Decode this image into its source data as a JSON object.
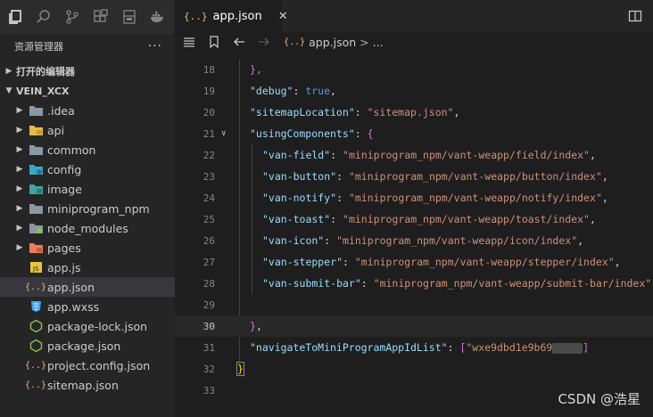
{
  "explorer": {
    "title": "资源管理器",
    "more": "···",
    "sections": [
      {
        "label": "打开的编辑器",
        "expanded": false
      },
      {
        "label": "VEIN_XCX",
        "expanded": true
      }
    ],
    "tree": [
      {
        "label": ".idea",
        "type": "folder",
        "color": "#8b97a1"
      },
      {
        "label": "api",
        "type": "folder",
        "color": "#e5b94b"
      },
      {
        "label": "common",
        "type": "folder",
        "color": "#8b97a1"
      },
      {
        "label": "config",
        "type": "folder",
        "color": "#3ba7c6"
      },
      {
        "label": "image",
        "type": "folder",
        "color": "#41a6a3"
      },
      {
        "label": "miniprogram_npm",
        "type": "folder",
        "color": "#8b97a1"
      },
      {
        "label": "node_modules",
        "type": "folder",
        "color": "#8bc34a"
      },
      {
        "label": "pages",
        "type": "folder",
        "color": "#f07b5a"
      },
      {
        "label": "app.js",
        "type": "js"
      },
      {
        "label": "app.json",
        "type": "json",
        "selected": true
      },
      {
        "label": "app.wxss",
        "type": "css"
      },
      {
        "label": "package-lock.json",
        "type": "node"
      },
      {
        "label": "package.json",
        "type": "node"
      },
      {
        "label": "project.config.json",
        "type": "json"
      },
      {
        "label": "sitemap.json",
        "type": "json"
      }
    ]
  },
  "tab": {
    "icon": "{..}",
    "label": "app.json",
    "close": "✕"
  },
  "breadcrumb": {
    "icon": "{..}",
    "file": "app.json",
    "sep": ">",
    "rest": "..."
  },
  "lines": [
    {
      "n": "18",
      "text_key": "l18"
    },
    {
      "n": "19"
    },
    {
      "n": "20"
    },
    {
      "n": "21"
    },
    {
      "n": "22"
    },
    {
      "n": "23"
    },
    {
      "n": "24"
    },
    {
      "n": "25"
    },
    {
      "n": "26"
    },
    {
      "n": "27"
    },
    {
      "n": "28"
    },
    {
      "n": "29"
    },
    {
      "n": "30"
    },
    {
      "n": "31"
    },
    {
      "n": "32"
    },
    {
      "n": "33"
    }
  ],
  "code": {
    "l18": "},",
    "debug_key": "\"debug\"",
    "debug_val": "true",
    "sitemap_key": "\"sitemapLocation\"",
    "sitemap_val": "\"sitemap.json\"",
    "using_key": "\"usingComponents\"",
    "components": [
      {
        "key": "\"van-field\"",
        "val": "\"miniprogram_npm/vant-weapp/field/index\""
      },
      {
        "key": "\"van-button\"",
        "val": "\"miniprogram_npm/vant-weapp/button/index\""
      },
      {
        "key": "\"van-notify\"",
        "val": "\"miniprogram_npm/vant-weapp/notify/index\""
      },
      {
        "key": "\"van-toast\"",
        "val": "\"miniprogram_npm/vant-weapp/toast/index\""
      },
      {
        "key": "\"van-icon\"",
        "val": "\"miniprogram_npm/vant-weapp/icon/index\""
      },
      {
        "key": "\"van-stepper\"",
        "val": "\"miniprogram_npm/vant-weapp/stepper/index\""
      },
      {
        "key": "\"van-submit-bar\"",
        "val": "\"miniprogram_npm/vant-weapp/submit-bar/index\""
      }
    ],
    "nav_key": "\"navigateToMiniProgramAppIdList\"",
    "nav_val": "\"wxe9dbd1e9b69"
  },
  "watermark": "CSDN @浩星"
}
